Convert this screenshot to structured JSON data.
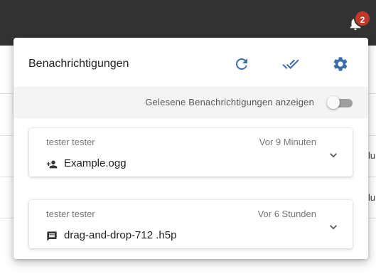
{
  "topbar": {
    "notification_count": "2",
    "bell_icon": "bell-icon"
  },
  "background": {
    "fragments": [
      "lu",
      "lu"
    ]
  },
  "panel": {
    "title": "Benachrichtigungen",
    "actions": [
      {
        "name": "refresh",
        "icon": "refresh-icon"
      },
      {
        "name": "mark-all-read",
        "icon": "double-check-icon"
      },
      {
        "name": "settings",
        "icon": "gear-icon"
      }
    ],
    "accent_color": "#3a6da8",
    "toggle": {
      "label": "Gelesene Benachrichtigungen anzeigen",
      "checked": false
    }
  },
  "notifications": [
    {
      "user": "tester tester",
      "time": "Vor 9 Minuten",
      "icon": "person-add-icon",
      "title": "Example.ogg"
    },
    {
      "user": "tester tester",
      "time": "Vor 6 Stunden",
      "icon": "comment-icon",
      "title": "drag-and-drop-712 .h5p"
    }
  ]
}
